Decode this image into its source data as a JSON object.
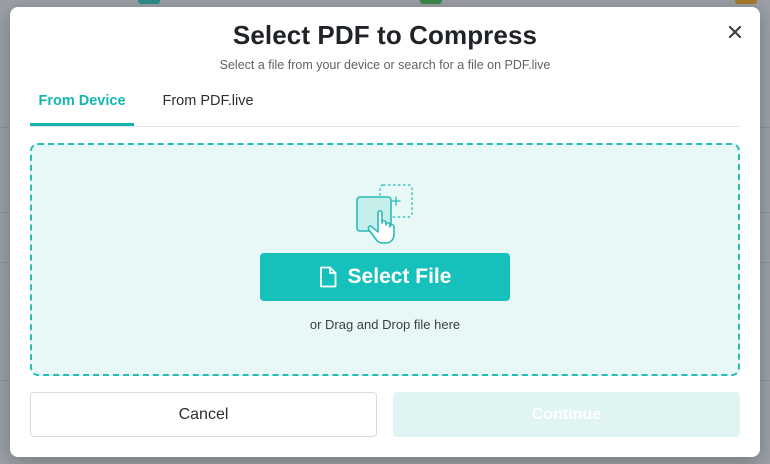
{
  "modal": {
    "title": "Select PDF to Compress",
    "subtitle": "Select a file from your device or search for a file on PDF.live"
  },
  "tabs": [
    {
      "label": "From Device",
      "active": true
    },
    {
      "label": "From PDF.live",
      "active": false
    }
  ],
  "dropzone": {
    "select_file_label": "Select File",
    "drag_text": "or Drag and Drop file here"
  },
  "footer": {
    "cancel_label": "Cancel",
    "continue_label": "Continue"
  },
  "icons": {
    "close": "close-icon",
    "upload": "upload-hand-icon",
    "file": "file-icon"
  },
  "colors": {
    "accent": "#15b5b0",
    "button": "#17c1bb",
    "dropzone_bg": "#e7f8f7",
    "continue_disabled": "#dff4f3"
  }
}
